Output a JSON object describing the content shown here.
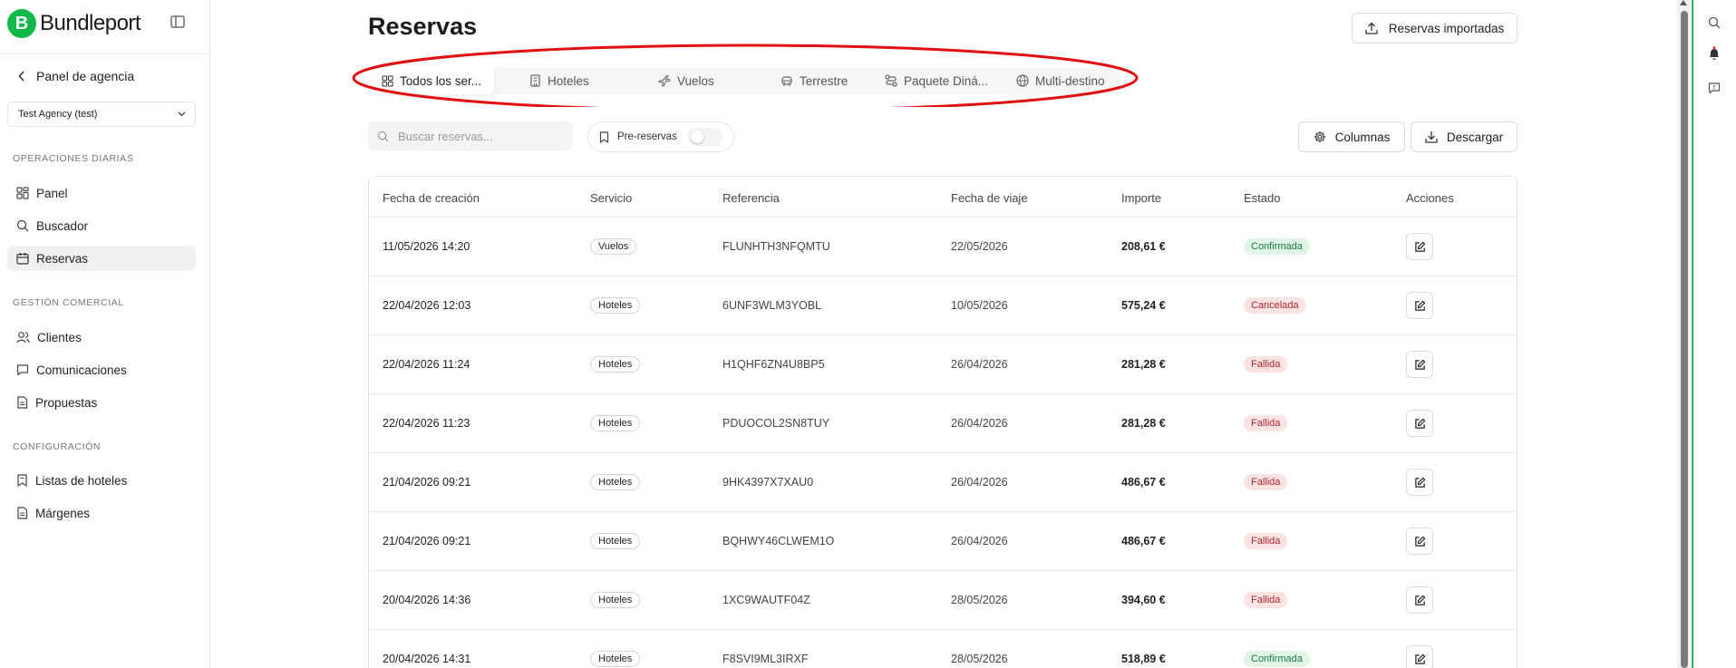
{
  "sidebar": {
    "brand": "Bundleport",
    "brand_initial": "B",
    "back_label": "Panel de agencia",
    "agency_select": "Test Agency (test)",
    "sections": [
      {
        "label": "OPERACIONES DIARIAS",
        "items": [
          {
            "label": "Panel",
            "icon": "grid-icon"
          },
          {
            "label": "Buscador",
            "icon": "search-icon"
          },
          {
            "label": "Reservas",
            "icon": "calendar-icon",
            "active": true
          }
        ]
      },
      {
        "label": "GESTIÓN COMERCIAL",
        "items": [
          {
            "label": "Clientes",
            "icon": "users-icon"
          },
          {
            "label": "Comunicaciones",
            "icon": "message-icon"
          },
          {
            "label": "Propuestas",
            "icon": "document-icon"
          }
        ]
      },
      {
        "label": "CONFIGURACIÓN",
        "items": [
          {
            "label": "Listas de hoteles",
            "icon": "bookmark-list-icon"
          },
          {
            "label": "Márgenes",
            "icon": "document-icon"
          }
        ]
      }
    ]
  },
  "header": {
    "title": "Reservas",
    "import_button": "Reservas importadas"
  },
  "tabs": [
    {
      "label": "Todos los ser...",
      "icon": "grid-icon",
      "active": true
    },
    {
      "label": "Hoteles",
      "icon": "hotel-icon"
    },
    {
      "label": "Vuelos",
      "icon": "plane-icon"
    },
    {
      "label": "Terrestre",
      "icon": "car-icon"
    },
    {
      "label": "Paquete Diná...",
      "icon": "route-icon"
    },
    {
      "label": "Multi-destino",
      "icon": "globe-icon"
    }
  ],
  "toolbar": {
    "search_placeholder": "Buscar reservas...",
    "prebook_label": "Pre-reservas",
    "prebook_enabled": false,
    "columns_button": "Columnas",
    "download_button": "Descargar"
  },
  "table": {
    "columns": [
      "Fecha de creación",
      "Servicio",
      "Referencia",
      "Fecha de viaje",
      "Importe",
      "Estado",
      "Acciones"
    ],
    "rows": [
      {
        "created": "11/05/2026 14:20",
        "service": "Vuelos",
        "reference": "FLUNHTH3NFQMTU",
        "travel": "22/05/2026",
        "amount": "208,61 €",
        "status": "Confirmada",
        "status_type": "success"
      },
      {
        "created": "22/04/2026 12:03",
        "service": "Hoteles",
        "reference": "6UNF3WLM3YOBL",
        "travel": "10/05/2026",
        "amount": "575,24 €",
        "status": "Cancelada",
        "status_type": "danger"
      },
      {
        "created": "22/04/2026 11:24",
        "service": "Hoteles",
        "reference": "H1QHF6ZN4U8BP5",
        "travel": "26/04/2026",
        "amount": "281,28 €",
        "status": "Fallida",
        "status_type": "danger"
      },
      {
        "created": "22/04/2026 11:23",
        "service": "Hoteles",
        "reference": "PDUOCOL2SN8TUY",
        "travel": "26/04/2026",
        "amount": "281,28 €",
        "status": "Fallida",
        "status_type": "danger"
      },
      {
        "created": "21/04/2026 09:21",
        "service": "Hoteles",
        "reference": "9HK4397X7XAU0",
        "travel": "26/04/2026",
        "amount": "486,67 €",
        "status": "Fallida",
        "status_type": "danger"
      },
      {
        "created": "21/04/2026 09:21",
        "service": "Hoteles",
        "reference": "BQHWY46CLWEM1O",
        "travel": "26/04/2026",
        "amount": "486,67 €",
        "status": "Fallida",
        "status_type": "danger"
      },
      {
        "created": "20/04/2026 14:36",
        "service": "Hoteles",
        "reference": "1XC9WAUTF04Z",
        "travel": "28/05/2026",
        "amount": "394,60 €",
        "status": "Fallida",
        "status_type": "danger"
      },
      {
        "created": "20/04/2026 14:31",
        "service": "Hoteles",
        "reference": "F8SVI9ML3IRXF",
        "travel": "28/05/2026",
        "amount": "518,89 €",
        "status": "Confirmada",
        "status_type": "success"
      }
    ]
  },
  "right_panel": {
    "icons": [
      "search-icon",
      "bell-icon",
      "feedback-icon"
    ]
  },
  "colors": {
    "brand": "#13b84a",
    "highlight": "#e01010",
    "success_bg": "#e2f6e8",
    "success_text": "#167a3d",
    "danger_bg": "#fbe3e3",
    "danger_text": "#a8262f"
  }
}
